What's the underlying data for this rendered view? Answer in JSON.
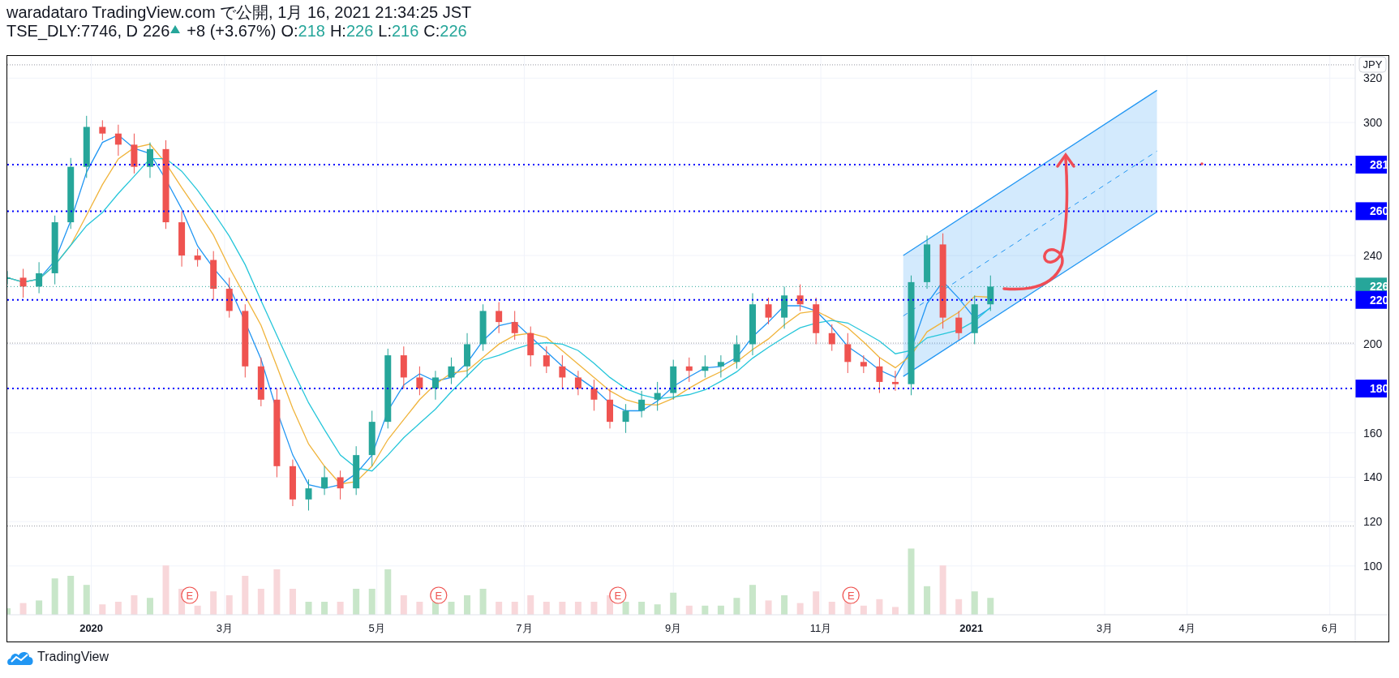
{
  "header": {
    "title": "waradataro TradingView.com で公開, 1月 16, 2021 21:34:25 JST",
    "symbol": "TSE_DLY:7746, D",
    "last": "226",
    "rising": true,
    "change": "+8 (+3.67%)",
    "ohlc": [
      {
        "label": "O:",
        "value": "218"
      },
      {
        "label": "H:",
        "value": "226"
      },
      {
        "label": "L:",
        "value": "216"
      },
      {
        "label": "C:",
        "value": "226"
      }
    ]
  },
  "chart": {
    "currency": "JPY",
    "price_axis": [
      "320",
      "300",
      "240",
      "200",
      "160",
      "140",
      "120",
      "100"
    ],
    "price_labels": [
      {
        "label": "281",
        "kind": "level"
      },
      {
        "label": "260",
        "kind": "level"
      },
      {
        "label": "226",
        "kind": "last"
      },
      {
        "label": "220",
        "kind": "level"
      },
      {
        "label": "180",
        "kind": "level"
      }
    ],
    "events": [
      "E",
      "E",
      "E",
      "E"
    ],
    "time_axis": [
      {
        "label": "2020",
        "kind": "year"
      },
      {
        "label": "3月",
        "kind": "month"
      },
      {
        "label": "5月",
        "kind": "month"
      },
      {
        "label": "7月",
        "kind": "month"
      },
      {
        "label": "9月",
        "kind": "month"
      },
      {
        "label": "11月",
        "kind": "month"
      },
      {
        "label": "2021",
        "kind": "year"
      },
      {
        "label": "3月",
        "kind": "month"
      },
      {
        "label": "4月",
        "kind": "month"
      },
      {
        "label": "6月",
        "kind": "month"
      }
    ]
  },
  "footer": {
    "brand": "TradingView"
  }
}
